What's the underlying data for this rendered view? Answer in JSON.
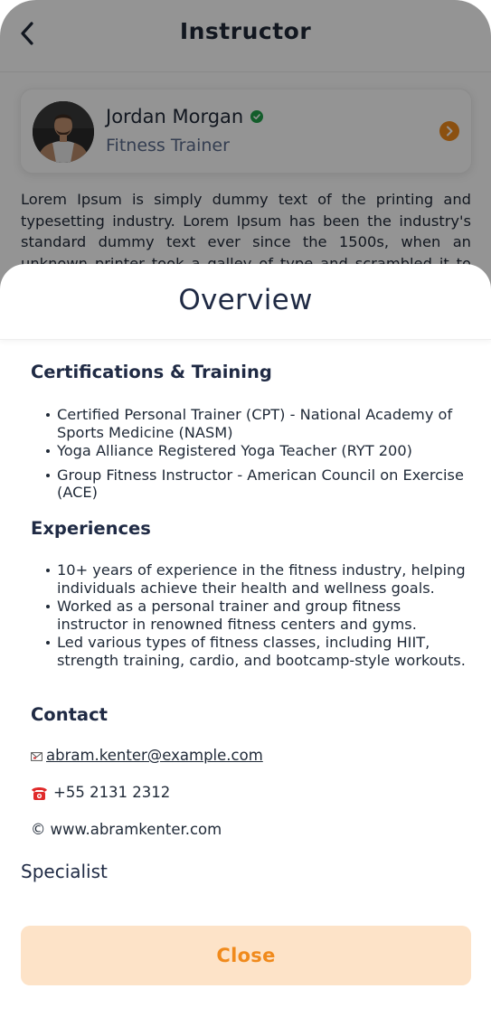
{
  "header": {
    "title": "Instructor",
    "back_icon": "chevron-left-icon"
  },
  "profile": {
    "name": "Jordan Morgan",
    "role": "Fitness Trainer",
    "verified_icon": "verified-check-icon",
    "action_icon": "chevron-right-icon",
    "accent_color": "#f08a1c"
  },
  "bio": "Lorem Ipsum is simply dummy text of the printing and typesetting industry. Lorem Ipsum has been the industry's standard dummy text ever since the 1500s, when an unknown printer took a galley of type and scrambled it to make a type",
  "sheet": {
    "title": "Overview",
    "certifications": {
      "title": "Certifications & Training",
      "items": [
        "Certified Personal Trainer (CPT) - National Academy of Sports Medicine (NASM)",
        "Yoga Alliance Registered Yoga Teacher (RYT 200)",
        "Group Fitness Instructor - American Council on Exercise (ACE)"
      ]
    },
    "experiences": {
      "title": "Experiences",
      "items": [
        "10+ years of experience in the fitness industry, helping individuals achieve their health and wellness goals.",
        "Worked as a personal trainer and group fitness instructor in renowned fitness centers and gyms.",
        "Led various types of fitness classes, including HIIT, strength training, cardio, and bootcamp-style workouts."
      ]
    },
    "contact": {
      "title": "Contact",
      "email": "abram.kenter@example.com",
      "email_icon": "envelope-icon",
      "phone": "+55 2131 2312",
      "phone_icon": "telephone-icon",
      "website": "www.abramkenter.com",
      "website_symbol": "©"
    },
    "specialist_title": "Specialist",
    "close_label": "Close"
  }
}
